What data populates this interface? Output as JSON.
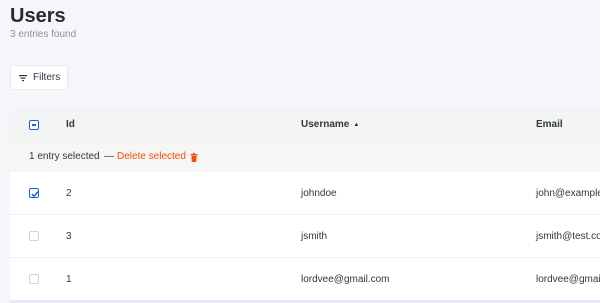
{
  "header": {
    "title": "Users",
    "subtitle": "3 entries found"
  },
  "toolbar": {
    "filters_label": "Filters",
    "filters_icon": "filter-icon"
  },
  "table": {
    "columns": [
      {
        "key": "id",
        "label": "Id"
      },
      {
        "key": "username",
        "label": "Username",
        "sort": "asc"
      },
      {
        "key": "email",
        "label": "Email"
      }
    ],
    "sort_indicator": "▲",
    "selection": {
      "text": "1 entry selected",
      "separator": "—",
      "delete_label": "Delete selected",
      "delete_icon": "trash-icon"
    },
    "rows": [
      {
        "checked": true,
        "id": "2",
        "username": "johndoe",
        "email": "john@example.com"
      },
      {
        "checked": false,
        "id": "3",
        "username": "jsmith",
        "email": "jsmith@test.com"
      },
      {
        "checked": false,
        "id": "1",
        "username": "lordvee@gmail.com",
        "email": "lordvee@gmail.com"
      }
    ]
  },
  "colors": {
    "accent": "#1c5de7",
    "danger": "#f64d0a",
    "background": "#f5f5fa"
  }
}
